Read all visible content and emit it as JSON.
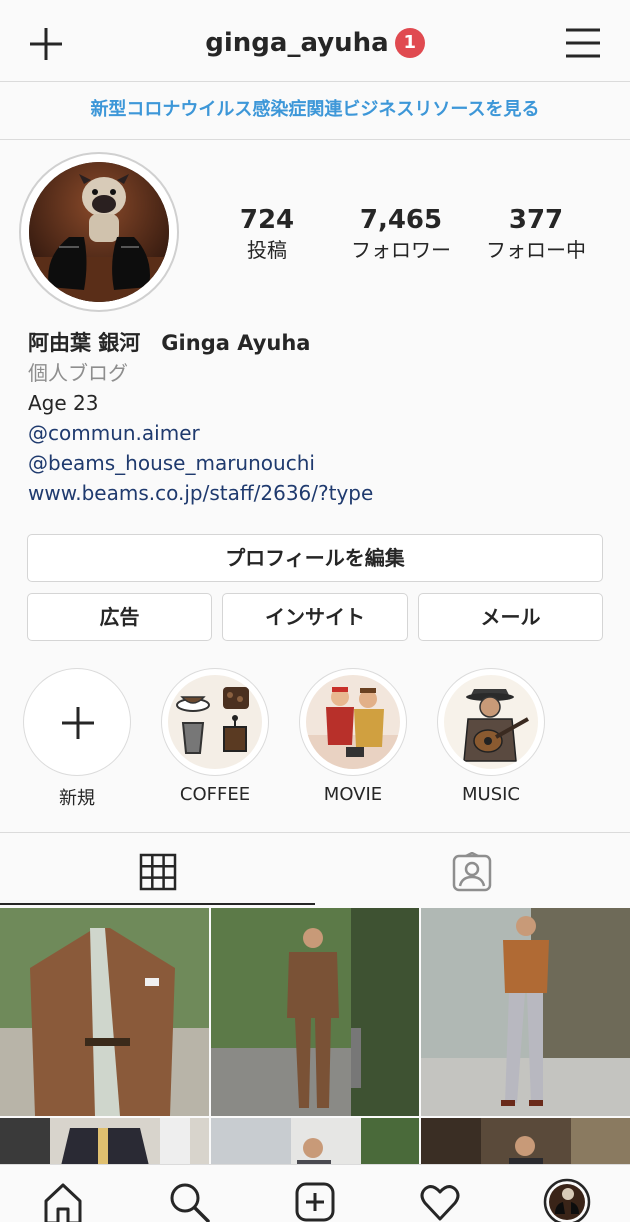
{
  "header": {
    "username": "ginga_ayuha",
    "notification_count": "1"
  },
  "banner": {
    "text": "新型コロナウイルス感染症関連ビジネスリソースを見る"
  },
  "stats": [
    {
      "value": "724",
      "label": "投稿"
    },
    {
      "value": "7,465",
      "label": "フォロワー"
    },
    {
      "value": "377",
      "label": "フォロー中"
    }
  ],
  "bio": {
    "name": "阿由葉 銀河　Ginga Ayuha",
    "category": "個人ブログ",
    "age": "Age 23",
    "links": [
      "@commun.aimer",
      "@beams_house_marunouchi",
      "www.beams.co.jp/staff/2636/?type"
    ]
  },
  "buttons": {
    "edit_profile": "プロフィールを編集",
    "ads": "広告",
    "insights": "インサイト",
    "email": "メール"
  },
  "highlights": [
    {
      "label": "新規",
      "icon": "plus-icon"
    },
    {
      "label": "COFFEE",
      "icon": "coffee-illustration"
    },
    {
      "label": "MOVIE",
      "icon": "movie-illustration"
    },
    {
      "label": "MUSIC",
      "icon": "music-illustration"
    }
  ],
  "tabs": [
    {
      "name": "grid-tab",
      "icon": "grid-icon",
      "active": true
    },
    {
      "name": "tagged-tab",
      "icon": "tagged-person-icon",
      "active": false
    }
  ],
  "bottom_nav": [
    "home-icon",
    "search-icon",
    "new-post-icon",
    "heart-icon",
    "profile-avatar"
  ],
  "colors": {
    "accent_link": "#3d97d8",
    "badge": "#e04a50",
    "bio_link": "#1f3a6e",
    "border": "#dbdbdb"
  }
}
